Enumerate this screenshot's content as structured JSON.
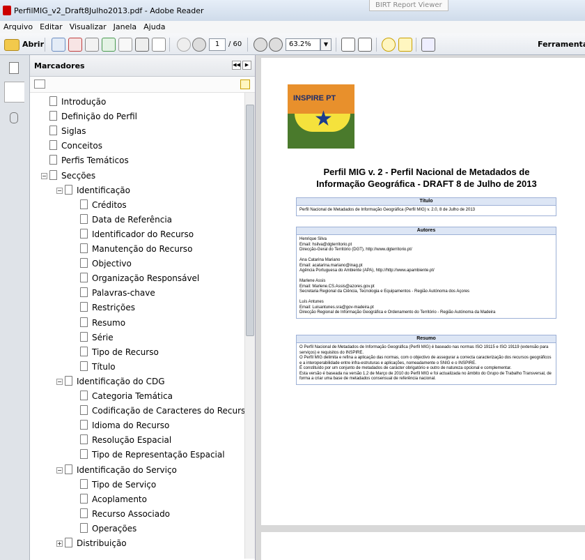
{
  "window": {
    "title": "PerfilMIG_v2_Draft8Julho2013.pdf - Adobe Reader",
    "tooltip": "BIRT Report Viewer"
  },
  "menu": [
    "Arquivo",
    "Editar",
    "Visualizar",
    "Janela",
    "Ajuda"
  ],
  "toolbar": {
    "open_label": "Abrir",
    "page_current": "1",
    "page_total": "/ 60",
    "zoom": "63.2%",
    "tools_label": "Ferramenta"
  },
  "panel": {
    "title": "Marcadores"
  },
  "bookmarks": [
    {
      "label": "Introdução",
      "level": 0
    },
    {
      "label": "Definição do Perfil",
      "level": 0
    },
    {
      "label": "Siglas",
      "level": 0
    },
    {
      "label": "Conceitos",
      "level": 0
    },
    {
      "label": "Perfis Temáticos",
      "level": 0
    },
    {
      "label": "Secções",
      "level": 0,
      "expanded": true
    },
    {
      "label": "Identificação",
      "level": 1,
      "expanded": true
    },
    {
      "label": "Créditos",
      "level": 2
    },
    {
      "label": "Data de Referência",
      "level": 2
    },
    {
      "label": "Identificador do Recurso",
      "level": 2
    },
    {
      "label": "Manutenção do Recurso",
      "level": 2
    },
    {
      "label": "Objectivo",
      "level": 2
    },
    {
      "label": "Organização Responsável",
      "level": 2
    },
    {
      "label": "Palavras-chave",
      "level": 2
    },
    {
      "label": "Restrições",
      "level": 2
    },
    {
      "label": "Resumo",
      "level": 2
    },
    {
      "label": "Série",
      "level": 2
    },
    {
      "label": "Tipo de Recurso",
      "level": 2
    },
    {
      "label": "Título",
      "level": 2
    },
    {
      "label": "Identificação do CDG",
      "level": 1,
      "expanded": true
    },
    {
      "label": "Categoria Temática",
      "level": 2
    },
    {
      "label": "Codificação de Caracteres do Recurso",
      "level": 2
    },
    {
      "label": "Idioma do Recurso",
      "level": 2
    },
    {
      "label": "Resolução Espacial",
      "level": 2
    },
    {
      "label": "Tipo de Representação Espacial",
      "level": 2
    },
    {
      "label": "Identificação do Serviço",
      "level": 1,
      "expanded": true
    },
    {
      "label": "Tipo de Serviço",
      "level": 2
    },
    {
      "label": "Acoplamento",
      "level": 2
    },
    {
      "label": "Recurso Associado",
      "level": 2
    },
    {
      "label": "Operações",
      "level": 2
    },
    {
      "label": "Distribuição",
      "level": 1,
      "expanded": false
    }
  ],
  "document": {
    "logo_text": "INSPIRE PT",
    "title_line1": "Perfil MIG v. 2 - Perfil Nacional de Metadados de",
    "title_line2": "Informação Geográfica - DRAFT 8 de Julho de 2013",
    "box1_title": "Título",
    "box1_text": "Perfil Nacional de Metadados de Informação Geográfica (Perfil MIG) v. 2.0, 8 de Julho de 2013",
    "box2_title": "Autores",
    "box2_text": "Henrique Silva\nEmail: hsilva@dgterritorio.pt\nDirecção-Geral do Território (DGT), http://www.dgterritorio.pt/\n\nAna Catarina Mariano\nEmail: acatarina.mariano@inag.pt\nAgência Portuguesa do Ambiente (APA), http://http://www.apambiente.pt/\n\nMarlene Assis\nEmail: Marlene.CS.Assis@azores.gov.pt\nSecretaria Regional da Ciência, Tecnologia e Equipamentos - Região Autónoma dos Açores\n\nLuís Antunes\nEmail: Luisantunes.sra@gov-madeira.pt\nDirecção Regional de Informação Geográfica e Ordenamento do Território - Região Autónoma da Madeira",
    "box3_title": "Resumo",
    "box3_text": "O Perfil Nacional de Metadados de Informação Geográfica (Perfil MIG) é baseado nas normas ISO 19115 e ISO 19119 (extensão para serviços) e requisitos do INSPIRE.\nO Perfil MIG delimita e refina a aplicação das normas, com o objectivo de assegurar a correcta caracterização dos recursos geográficos e a interoperabilidade entre infra-estruturas e aplicações, nomeadamente o SNIG e o INSPIRE.\nÉ constituído por um conjunto de metadados de carácter obrigatório e outro de natureza opcional e complementar.\nEsta versão é baseada na versão 1.2 de Março de 2010 do Perfil MIG e foi actualizada no âmbito do Grupo de Trabalho Transversal, de forma a criar uma base de metadados consensual de referência nacional."
  }
}
